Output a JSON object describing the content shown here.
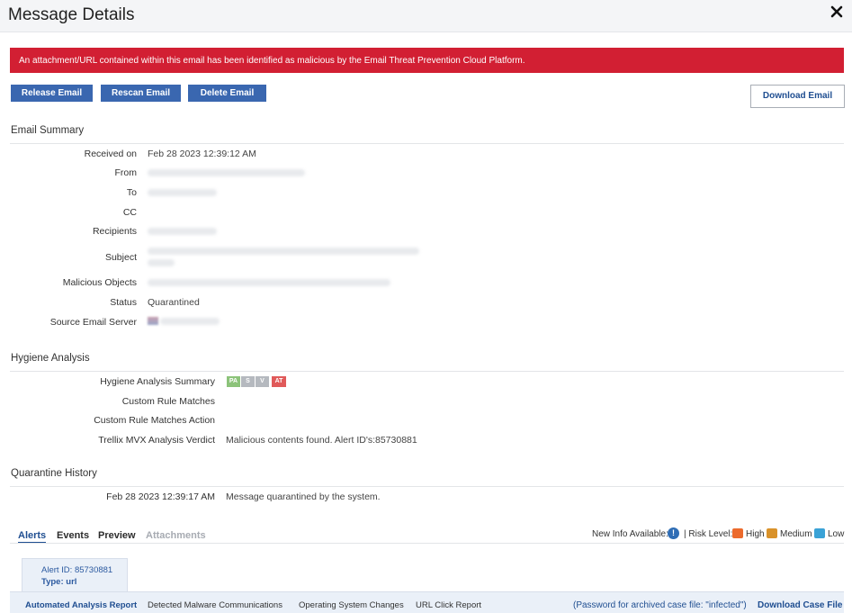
{
  "window": {
    "title": "Message Details"
  },
  "banner": {
    "text": "An attachment/URL contained within this email has been identified as malicious by the Email Threat Prevention Cloud Platform."
  },
  "actions": {
    "release": "Release Email",
    "rescan": "Rescan Email",
    "delete": "Delete Email",
    "download": "Download Email"
  },
  "email_summary": {
    "heading": "Email Summary",
    "received_label": "Received on",
    "received_value": "Feb 28 2023 12:39:12 AM",
    "from_label": "From",
    "to_label": "To",
    "cc_label": "CC",
    "recipients_label": "Recipients",
    "subject_label": "Subject",
    "malicious_label": "Malicious Objects",
    "status_label": "Status",
    "status_value": "Quarantined",
    "server_label": "Source Email Server"
  },
  "hygiene": {
    "heading": "Hygiene Analysis",
    "summary_label": "Hygiene Analysis Summary",
    "badges": [
      {
        "text": "PA",
        "color": "#8cc37a"
      },
      {
        "text": "S",
        "color": "#b5b9bf"
      },
      {
        "text": "V",
        "color": "#b5b9bf"
      },
      {
        "text": "AT",
        "color": "#e05a5a"
      }
    ],
    "rule_matches_label": "Custom Rule Matches",
    "rule_action_label": "Custom Rule Matches Action",
    "verdict_label": "Trellix MVX Analysis Verdict",
    "verdict_value": "Malicious contents found. Alert ID's:85730881"
  },
  "quarantine": {
    "heading": "Quarantine History",
    "time": "Feb 28 2023 12:39:17 AM",
    "message": "Message quarantined by the system."
  },
  "tabs": [
    "Alerts",
    "Events",
    "Preview",
    "Attachments"
  ],
  "legend": {
    "new_info": "New Info Available:",
    "new_info_glyph": "!",
    "separator": "| Risk Level:",
    "high": "High",
    "medium": "Medium",
    "low": "Low",
    "colors": {
      "high": "#ec6a2c",
      "medium": "#d9922a",
      "low": "#3aa2d6"
    }
  },
  "alert_card": {
    "id_line": "Alert ID: 85730881",
    "type_line": "Type: url"
  },
  "report_tabs": [
    "Automated Analysis Report",
    "Detected Malware Communications",
    "Operating System Changes",
    "URL Click Report"
  ],
  "case_file": {
    "password_note": "(Password for archived case file: \"infected\")",
    "download": "Download Case File"
  }
}
